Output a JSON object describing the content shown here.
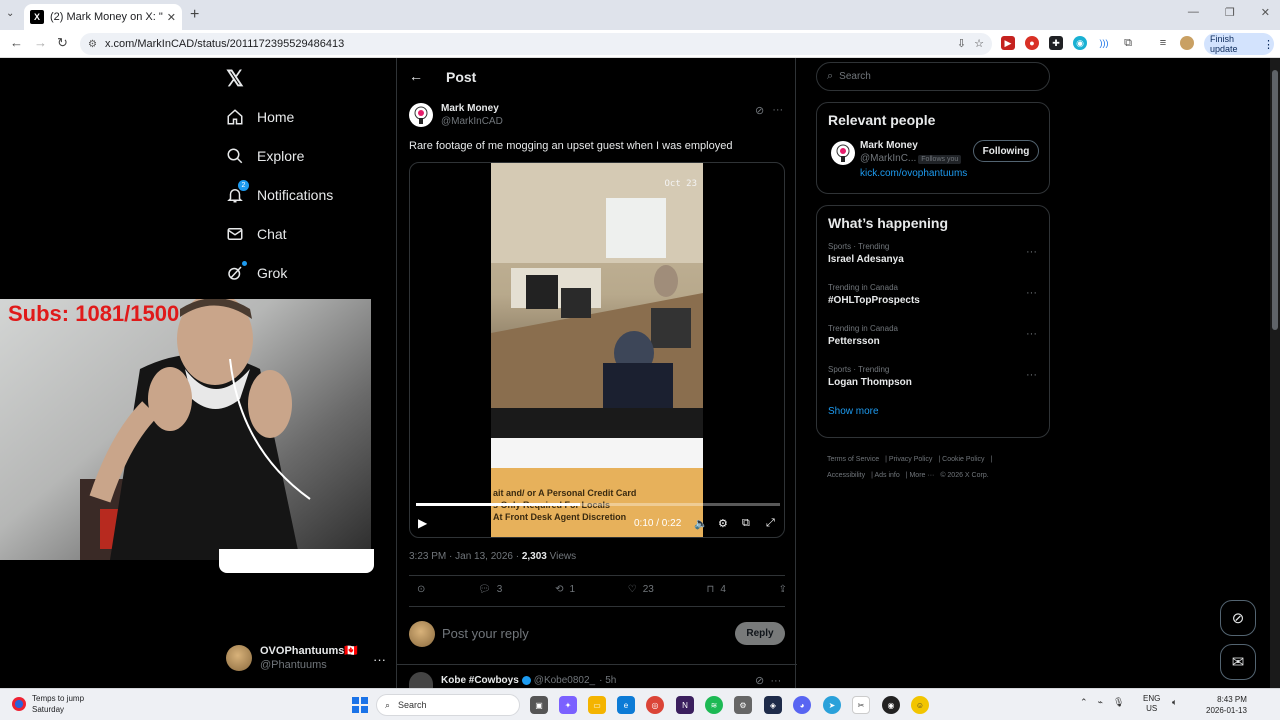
{
  "browser": {
    "tab_title": "(2) Mark Money on X: \"Rare foo",
    "url": "x.com/MarkInCAD/status/2011172395529486413",
    "finish_update": "Finish update"
  },
  "nav": {
    "home": "Home",
    "explore": "Explore",
    "notifications": "Notifications",
    "notifications_badge": "2",
    "chat": "Chat",
    "grok": "Grok"
  },
  "overlay": {
    "subs_text": "Subs: 1081/1500"
  },
  "account": {
    "name": "OVOPhantuums🇨🇦",
    "handle": "@Phantuums"
  },
  "post": {
    "header": "Post",
    "author_name": "Mark Money",
    "author_handle": "@MarkInCAD",
    "text": "Rare footage of me mogging an upset guest when I was employed",
    "video_date": "Oct 23",
    "video_sign_line1": "ait and/ or A Personal Credit Card",
    "video_sign_line2": "s Only Required For Locals",
    "video_sign_line3": "At Front Desk Agent Discretion",
    "video_time": "0:10 / 0:22",
    "video_progress": 0.45,
    "timestamp": "3:23 PM · Jan 13, 2026 · ",
    "views_count": "2,303",
    "views_label": " Views",
    "replies": "3",
    "reposts": "1",
    "likes": "23",
    "bookmarks": "4",
    "reply_placeholder": "Post your reply",
    "reply_button": "Reply"
  },
  "next_tweet": {
    "name": "Kobe #Cowboys",
    "handle": "@Kobe0802_",
    "time": "· 5h"
  },
  "search": {
    "placeholder": "Search"
  },
  "relevant": {
    "title": "Relevant people",
    "name": "Mark Money",
    "handle": "@MarkInC...",
    "follows_you": "Follows you",
    "link": "kick.com/ovophantuums",
    "button": "Following"
  },
  "happening": {
    "title": "What’s happening",
    "trends": [
      {
        "context": "Sports · Trending",
        "name": "Israel Adesanya"
      },
      {
        "context": "Trending in Canada",
        "name": "#OHLTopProspects"
      },
      {
        "context": "Trending in Canada",
        "name": "Pettersson"
      },
      {
        "context": "Sports · Trending",
        "name": "Logan Thompson"
      }
    ],
    "show_more": "Show more"
  },
  "footer": {
    "terms": "Terms of Service",
    "privacy": "Privacy Policy",
    "cookie": "Cookie Policy",
    "accessibility": "Accessibility",
    "ads": "Ads info",
    "more": "More ···",
    "copyright": "© 2026 X Corp."
  },
  "taskbar": {
    "weather_line1": "Temps to jump",
    "weather_line2": "Saturday",
    "search": "Search",
    "lang1": "ENG",
    "lang2": "US",
    "time": "8:43 PM",
    "date": "2026-01-13"
  },
  "colors": {
    "accent": "#1d9bf0",
    "background": "#000000",
    "border": "#2f3336",
    "muted": "#71767b"
  }
}
